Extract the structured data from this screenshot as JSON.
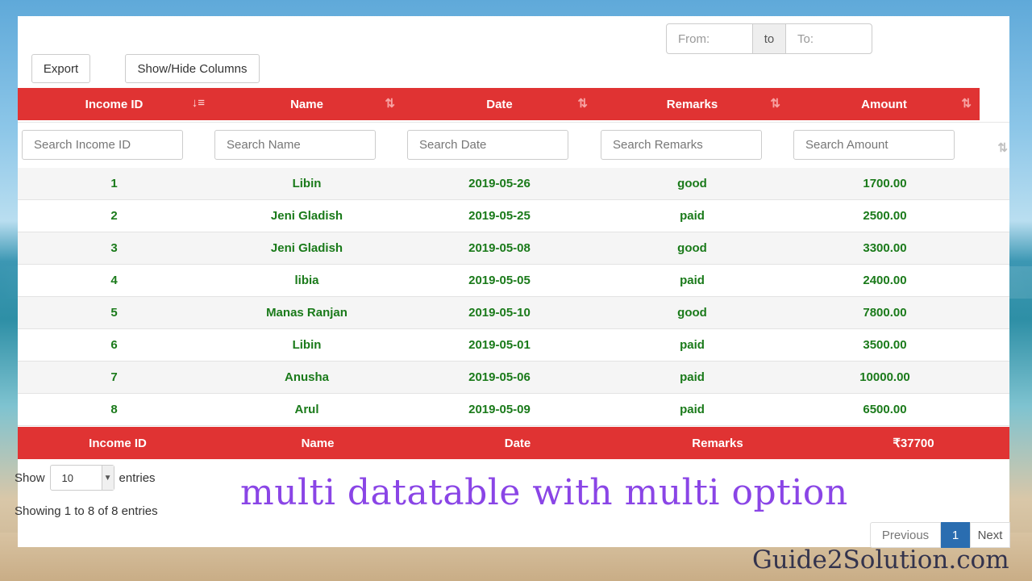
{
  "toolbar": {
    "export_label": "Export",
    "columns_label": "Show/Hide Columns"
  },
  "date_range": {
    "from_placeholder": "From:",
    "separator": "to",
    "to_placeholder": "To:"
  },
  "table": {
    "columns": [
      "Income ID",
      "Name",
      "Date",
      "Remarks",
      "Amount"
    ],
    "filters": [
      "Search Income ID",
      "Search Name",
      "Search Date",
      "Search Remarks",
      "Search Amount"
    ],
    "rows": [
      [
        "1",
        "Libin",
        "2019-05-26",
        "good",
        "1700.00"
      ],
      [
        "2",
        "Jeni Gladish",
        "2019-05-25",
        "paid",
        "2500.00"
      ],
      [
        "3",
        "Jeni Gladish",
        "2019-05-08",
        "good",
        "3300.00"
      ],
      [
        "4",
        "libia",
        "2019-05-05",
        "paid",
        "2400.00"
      ],
      [
        "5",
        "Manas Ranjan",
        "2019-05-10",
        "good",
        "7800.00"
      ],
      [
        "6",
        "Libin",
        "2019-05-01",
        "paid",
        "3500.00"
      ],
      [
        "7",
        "Anusha",
        "2019-05-06",
        "paid",
        "10000.00"
      ],
      [
        "8",
        "Arul",
        "2019-05-09",
        "paid",
        "6500.00"
      ]
    ],
    "footer": [
      "Income ID",
      "Name",
      "Date",
      "Remarks",
      "₹37700"
    ]
  },
  "length": {
    "show_label": "Show",
    "value": "10",
    "entries_label": "entries"
  },
  "info": "Showing 1 to 8 of 8 entries",
  "pagination": {
    "previous": "Previous",
    "current": "1",
    "next": "Next"
  },
  "overlay_title": "multi datatable with multi option",
  "brand": "Guide2Solution.com",
  "colors": {
    "header": "#e03333",
    "cell_text": "#1a7a1a",
    "title": "#8a45e6",
    "page_active": "#2a6db0"
  }
}
